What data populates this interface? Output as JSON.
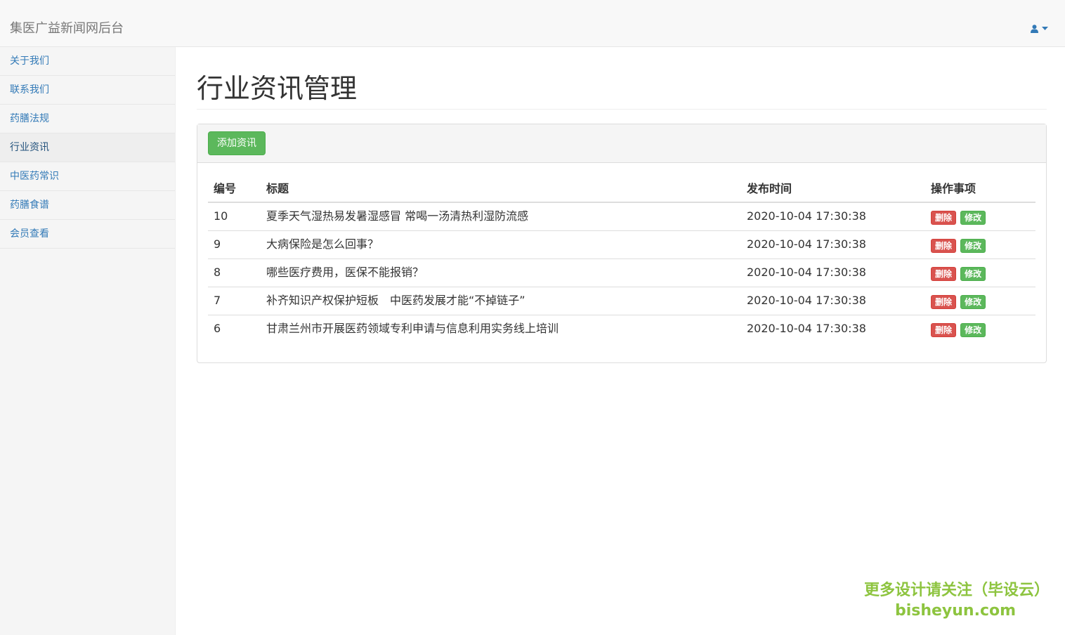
{
  "navbar": {
    "brand": "集医广益新闻网后台",
    "user_icon": "user-icon",
    "caret_icon": "caret-down-icon"
  },
  "sidebar": {
    "items": [
      {
        "label": "关于我们",
        "active": false
      },
      {
        "label": "联系我们",
        "active": false
      },
      {
        "label": "药膳法规",
        "active": false
      },
      {
        "label": "行业资讯",
        "active": true
      },
      {
        "label": "中医药常识",
        "active": false
      },
      {
        "label": "药膳食谱",
        "active": false
      },
      {
        "label": "会员查看",
        "active": false
      }
    ]
  },
  "main": {
    "title": "行业资讯管理",
    "add_button": "添加资讯",
    "table": {
      "headers": [
        "编号",
        "标题",
        "发布时间",
        "操作事项"
      ],
      "rows": [
        {
          "id": "10",
          "title": "夏季天气湿热易发暑湿感冒 常喝一汤清热利湿防流感",
          "time": "2020-10-04 17:30:38"
        },
        {
          "id": "9",
          "title": "大病保险是怎么回事？",
          "time": "2020-10-04 17:30:38"
        },
        {
          "id": "8",
          "title": "哪些医疗费用，医保不能报销？",
          "time": "2020-10-04 17:30:38"
        },
        {
          "id": "7",
          "title": "补齐知识产权保护短板　中医药发展才能“不掉链子”",
          "time": "2020-10-04 17:30:38"
        },
        {
          "id": "6",
          "title": "甘肃兰州市开展医药领域专利申请与信息利用实务线上培训",
          "time": "2020-10-04 17:30:38"
        }
      ],
      "delete_label": "删除",
      "edit_label": "修改"
    }
  },
  "watermark": {
    "line1": "更多设计请关注（毕设云）",
    "line2": "bisheyun.com"
  },
  "colors": {
    "link": "#337ab7",
    "success": "#5cb85c",
    "danger": "#d9534f",
    "watermark": "#8dc43f"
  }
}
